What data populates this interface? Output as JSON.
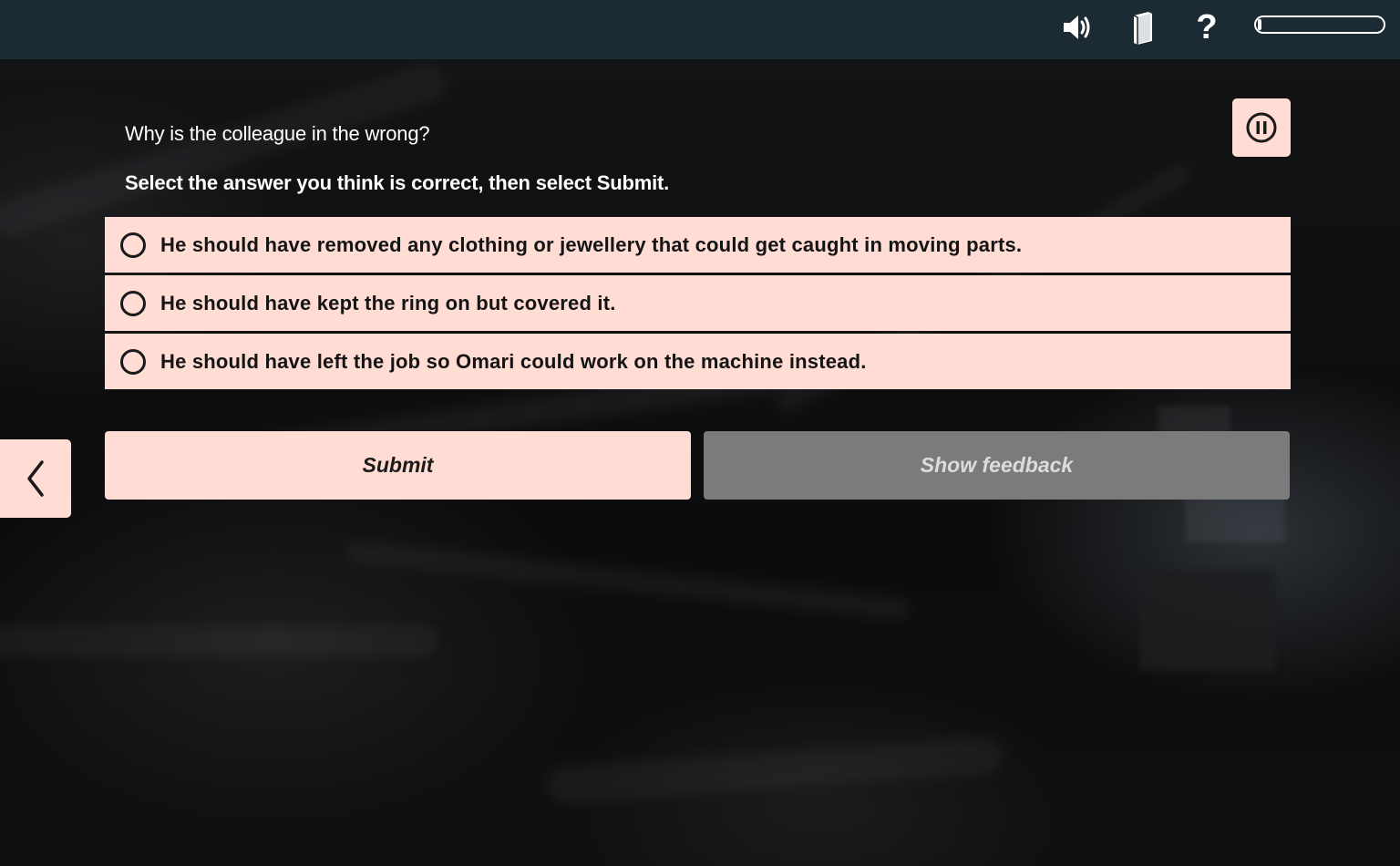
{
  "topbar": {
    "icons": [
      "speaker-icon",
      "book-icon",
      "help-icon"
    ],
    "help_glyph": "?",
    "progress_fraction": 0.02
  },
  "question": {
    "prompt": "Why is the colleague in the wrong?",
    "instruction": "Select the answer you think is correct, then select Submit.",
    "options": [
      {
        "label": "He should have removed any clothing or jewellery that could get caught in moving parts."
      },
      {
        "label": "He should have kept the ring on but covered it."
      },
      {
        "label": "He should have left the job so Omari could work on the machine instead."
      }
    ]
  },
  "buttons": {
    "submit": "Submit",
    "show_feedback": "Show feedback"
  },
  "colors": {
    "topbar": "#1c2a33",
    "option_bg": "#ffddd4",
    "disabled_button": "#7b7b7b"
  },
  "icons": {
    "pause": "pause-icon",
    "back": "chevron-left-icon"
  }
}
